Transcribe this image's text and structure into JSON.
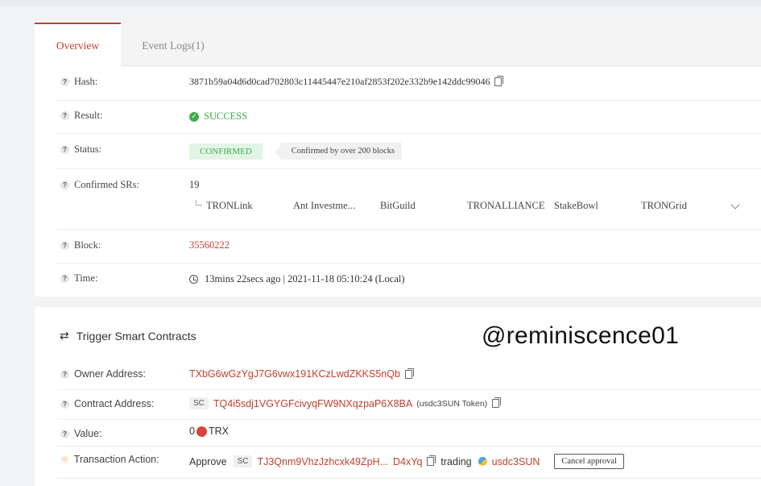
{
  "tabs": [
    "Overview",
    "Event Logs(1)"
  ],
  "overview": {
    "hash_label": "Hash:",
    "hash": "3871b59a04d6d0cad702803c11445447e210af2853f202e332b9e142ddc99046",
    "result_label": "Result:",
    "result": "SUCCESS",
    "status_label": "Status:",
    "status": "CONFIRMED",
    "status_note": "Confirmed by over 200 blocks",
    "srs_label": "Confirmed SRs:",
    "srs_count": "19",
    "srs": [
      "TRONLink",
      "Ant Investme...",
      "BitGuild",
      "TRONALLIANCE",
      "StakeBowl",
      "TRONGrid"
    ],
    "block_label": "Block:",
    "block": "35560222",
    "time_label": "Time:",
    "time": "13mins 22secs ago | 2021-11-18 05:10:24 (Local)"
  },
  "contract": {
    "title": "Trigger Smart Contracts",
    "watermark": "@reminiscence01",
    "owner_label": "Owner Address:",
    "owner": "TXbG6wGzYgJ7G6vwx191KCzLwdZKKS5nQb",
    "contract_label": "Contract Address:",
    "sc_tag": "SC",
    "contract_address": "TQ4i5sdj1VGYGFcivyqFW9NXqzpaP6X8BA",
    "contract_token": "(usdc3SUN Token)",
    "value_label": "Value:",
    "value_amount": "0",
    "value_unit": "TRX",
    "action_label": "Transaction Action:",
    "action_verb": "Approve",
    "action_address_start": "TJ3Qnm9VhzJzhcxk49ZpH...",
    "action_address_end": "D4xYq",
    "action_mid": "trading",
    "action_token": "usdc3SUN",
    "cancel_label": "Cancel approval"
  },
  "colors": {
    "accent": "#c0412f",
    "success": "#3bae4e",
    "background": "#f2f3f5"
  }
}
